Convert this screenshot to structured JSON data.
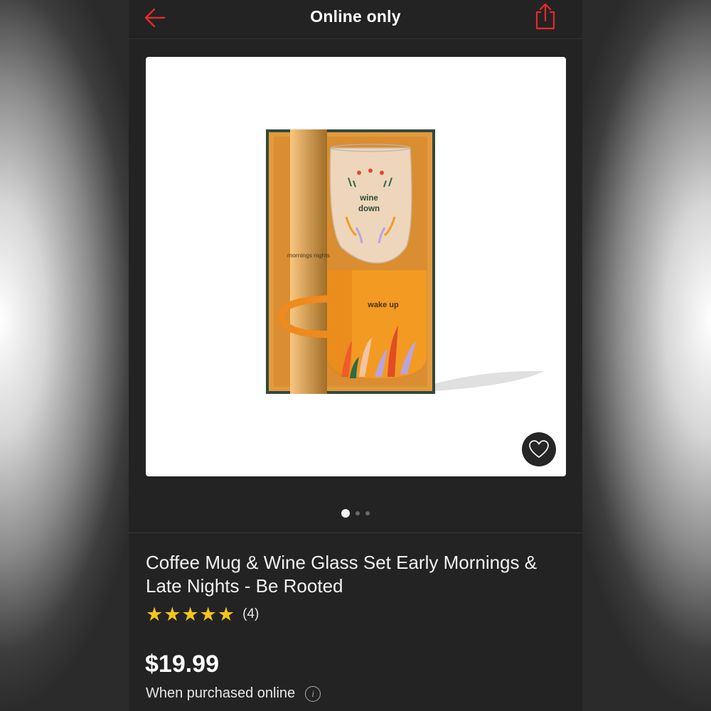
{
  "header": {
    "title": "Online only",
    "back_icon": "arrow-left-icon",
    "share_icon": "share-icon",
    "accent_color": "#e52a2a"
  },
  "gallery": {
    "image_count": 3,
    "active_index": 0,
    "favorite_icon": "heart-outline-icon",
    "image_text": {
      "sleeve": "mornings nights",
      "glass_print": "wine down",
      "mug_print": "wake up"
    }
  },
  "product": {
    "title": "Coffee Mug & Wine Glass Set Early Mornings & Late Nights - Be Rooted",
    "rating": 5,
    "rating_max": 5,
    "review_count": "(4)",
    "price": "$19.99",
    "price_note": "When purchased online",
    "info_icon": "info-icon",
    "star_color": "#f5c518"
  }
}
